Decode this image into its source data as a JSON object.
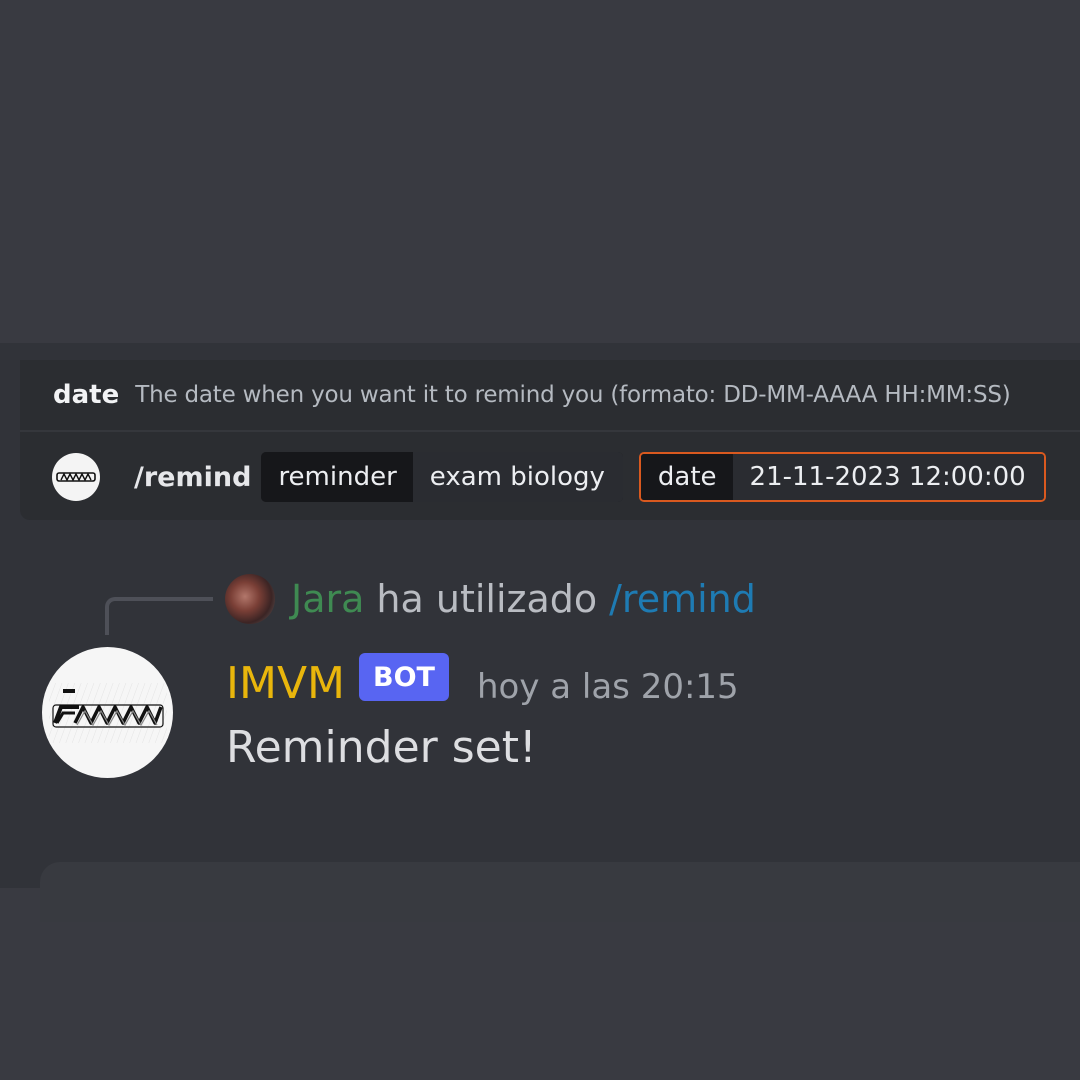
{
  "autocomplete": {
    "option_name": "date",
    "option_description": "The date when you want it to remind you (formato: DD-MM-AAAA HH:MM:SS)",
    "command": "/remind",
    "params": [
      {
        "key": "reminder",
        "value": "exam biology"
      },
      {
        "key": "date",
        "value": "21-11-2023 12:00:00"
      }
    ],
    "active_border_color": "#d9591f"
  },
  "message": {
    "reply": {
      "username": "Jara",
      "text": "ha utilizado",
      "command": "/remind"
    },
    "author": "IMVM",
    "author_color": "#e9b60c",
    "tag": "BOT",
    "tag_color": "#5865f2",
    "timestamp": "hoy a las 20:15",
    "content": "Reminder set!"
  },
  "icons": {
    "bot_avatar": "imvm-logo-icon",
    "user_avatar": "user-avatar-photo"
  }
}
